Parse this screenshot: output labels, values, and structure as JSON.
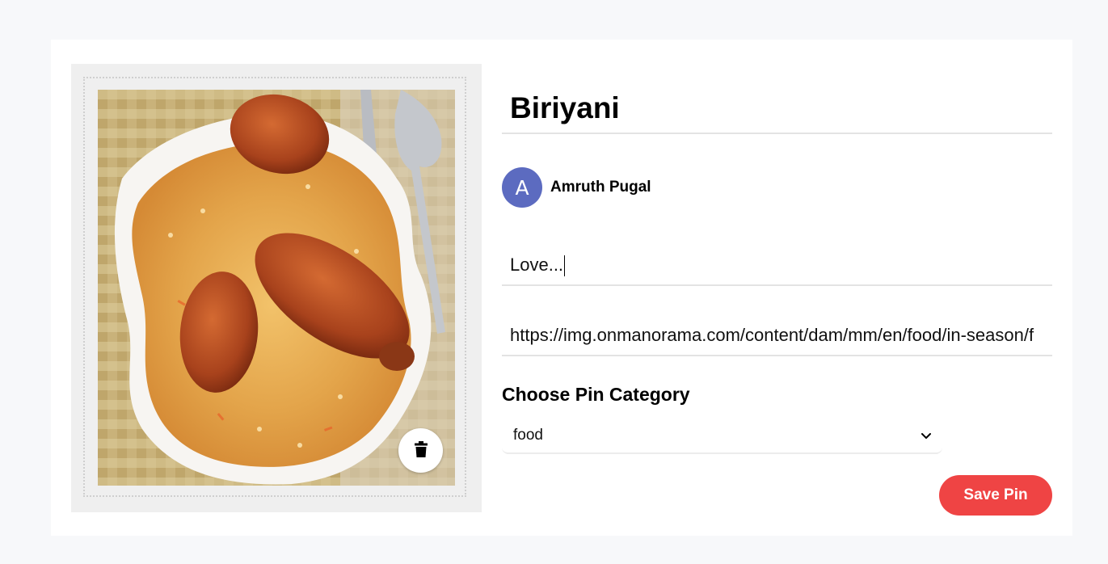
{
  "pin_form": {
    "title_value": "Biriyani",
    "author": {
      "avatar_initial": "A",
      "name": "Amruth Pugal"
    },
    "about_value": "Love...",
    "destination_value": "https://img.onmanorama.com/content/dam/mm/en/food/in-season/f",
    "category_label": "Choose Pin Category",
    "category_selected": "food",
    "save_label": "Save Pin"
  },
  "image_panel": {
    "photo_subject": "chicken biriyani on a white plate",
    "delete_icon": "trash-icon"
  },
  "colors": {
    "accent": "#ef4444",
    "avatar": "#5c6bc0",
    "page_bg": "#f7f8fa",
    "upload_bg": "#efefef"
  }
}
